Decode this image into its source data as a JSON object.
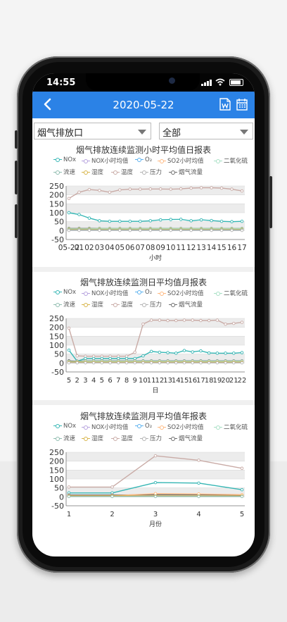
{
  "status": {
    "time": "14:55"
  },
  "header": {
    "title": "2020-05-22"
  },
  "filters": {
    "station": "烟气排放口",
    "scope": "全部"
  },
  "legend": {
    "row1": [
      "NOx",
      "NOX小时均值",
      "O₂",
      "SO2小时均值",
      "二氧化硫"
    ],
    "row2": [
      "流速",
      "湿度",
      "温度",
      "压力",
      "烟气流量"
    ]
  },
  "colors": {
    "header": "#2b82e6",
    "nox": "#35b6b4",
    "nox_avg": "#b6a2de",
    "o2": "#5ab1ef",
    "so2_avg": "#ffb980",
    "so2": "#a8e0c5",
    "flow": "#8fbcaf",
    "humidity": "#d8b54a",
    "temperature": "#c9aba6",
    "pressure": "#b3b3b3",
    "gas_flow": "#6e6e6e"
  },
  "chart_data": [
    {
      "type": "line",
      "title": "烟气排放连续监测小时平均值日报表",
      "xlabel": "小时",
      "ylabel": "",
      "ylim": [
        -50,
        250
      ],
      "yticks": [
        250,
        200,
        150,
        100,
        50,
        0,
        -50
      ],
      "categories": [
        "05-22",
        "01",
        "02",
        "03",
        "04",
        "05",
        "06",
        "07",
        "08",
        "09",
        "10",
        "11",
        "12",
        "13",
        "14",
        "15",
        "16",
        "17"
      ],
      "x_tick_labels": [
        "05-22",
        "01",
        "02",
        "03",
        "04",
        "05",
        "06",
        "07",
        "08",
        "09",
        "10",
        "11",
        "12",
        "13",
        "14",
        "15",
        "16",
        "17"
      ],
      "series": [
        {
          "name": "温度",
          "color": "#c9aba6",
          "values": [
            180,
            215,
            230,
            225,
            215,
            228,
            232,
            232,
            233,
            233,
            232,
            234,
            238,
            240,
            240,
            238,
            232,
            222
          ]
        },
        {
          "name": "NOx",
          "color": "#35b6b4",
          "values": [
            100,
            90,
            70,
            55,
            52,
            52,
            52,
            52,
            55,
            60,
            62,
            63,
            55,
            60,
            56,
            52,
            50,
            52
          ]
        },
        {
          "name": "烟气流量",
          "color": "#6e6e6e",
          "values": [
            12,
            12,
            12,
            12,
            12,
            12,
            12,
            12,
            12,
            12,
            12,
            12,
            12,
            12,
            12,
            12,
            12,
            12
          ]
        },
        {
          "name": "二氧化硫",
          "color": "#a8e0c5",
          "values": [
            10,
            10,
            10,
            11,
            11,
            11,
            11,
            11,
            11,
            11,
            11,
            11,
            11,
            11,
            11,
            11,
            11,
            11
          ]
        },
        {
          "name": "湿度",
          "color": "#d8b54a",
          "values": [
            7,
            7,
            7,
            7,
            7,
            7,
            7,
            7,
            7,
            7,
            7,
            7,
            7,
            7,
            7,
            7,
            7,
            7
          ]
        },
        {
          "name": "流速",
          "color": "#8fbcaf",
          "values": [
            4,
            4,
            4,
            4,
            4,
            4,
            4,
            4,
            4,
            4,
            4,
            4,
            4,
            4,
            4,
            4,
            4,
            4
          ]
        },
        {
          "name": "压力",
          "color": "#b3b3b3",
          "values": [
            1,
            1,
            1,
            1,
            1,
            1,
            1,
            1,
            1,
            1,
            1,
            1,
            1,
            1,
            1,
            1,
            1,
            1
          ]
        }
      ]
    },
    {
      "type": "line",
      "title": "烟气排放连续监测日平均值月报表",
      "xlabel": "日",
      "ylabel": "",
      "ylim": [
        -50,
        250
      ],
      "yticks": [
        250,
        200,
        150,
        100,
        50,
        0,
        -50
      ],
      "categories": [
        "5",
        "2",
        "3",
        "4",
        "5",
        "6",
        "7",
        "8",
        "9",
        "10",
        "11",
        "12",
        "13",
        "14",
        "15",
        "16",
        "17",
        "18",
        "19",
        "20",
        "21",
        "22"
      ],
      "x_tick_labels": [
        "5",
        "2",
        "3",
        "4",
        "5",
        "6",
        "7",
        "8",
        "9",
        "10",
        "11",
        "12",
        "13",
        "14",
        "15",
        "16",
        "17",
        "18",
        "19",
        "20",
        "21",
        "22"
      ],
      "series": [
        {
          "name": "温度",
          "color": "#c9aba6",
          "values": [
            195,
            40,
            38,
            38,
            38,
            38,
            38,
            38,
            60,
            218,
            240,
            240,
            238,
            238,
            240,
            240,
            238,
            238,
            240,
            218,
            222,
            228
          ]
        },
        {
          "name": "NOx",
          "color": "#35b6b4",
          "values": [
            72,
            10,
            25,
            25,
            25,
            25,
            25,
            25,
            25,
            40,
            65,
            60,
            58,
            55,
            70,
            62,
            68,
            56,
            55,
            55,
            55,
            58
          ]
        },
        {
          "name": "烟气流量",
          "color": "#6e6e6e",
          "values": [
            12,
            10,
            12,
            12,
            12,
            12,
            12,
            12,
            12,
            12,
            12,
            12,
            12,
            12,
            12,
            12,
            12,
            12,
            12,
            12,
            12,
            12
          ]
        },
        {
          "name": "二氧化硫",
          "color": "#a8e0c5",
          "values": [
            8,
            8,
            10,
            10,
            10,
            10,
            10,
            10,
            10,
            10,
            10,
            10,
            10,
            10,
            10,
            10,
            10,
            10,
            10,
            10,
            10,
            10
          ]
        },
        {
          "name": "湿度",
          "color": "#d8b54a",
          "values": [
            5,
            5,
            5,
            5,
            5,
            5,
            5,
            5,
            5,
            5,
            5,
            5,
            5,
            5,
            5,
            5,
            5,
            5,
            5,
            5,
            5,
            5
          ]
        },
        {
          "name": "压力",
          "color": "#b3b3b3",
          "values": [
            1,
            1,
            1,
            1,
            1,
            1,
            1,
            1,
            1,
            1,
            1,
            1,
            1,
            1,
            1,
            1,
            1,
            1,
            1,
            1,
            1,
            1
          ]
        }
      ]
    },
    {
      "type": "line",
      "title": "烟气排放连续监测月平均值年报表",
      "xlabel": "月份",
      "ylabel": "",
      "ylim": [
        -50,
        250
      ],
      "yticks": [
        250,
        200,
        150,
        100,
        50,
        0,
        -50
      ],
      "categories": [
        "1",
        "2",
        "3",
        "4",
        "5"
      ],
      "x_tick_labels": [
        "1",
        "2",
        "3",
        "4",
        "5"
      ],
      "series": [
        {
          "name": "温度",
          "color": "#c9aba6",
          "values": [
            55,
            55,
            230,
            205,
            160
          ]
        },
        {
          "name": "NOx",
          "color": "#35b6b4",
          "values": [
            22,
            22,
            80,
            77,
            40
          ]
        },
        {
          "name": "烟气流量",
          "color": "#6e6e6e",
          "values": [
            10,
            10,
            12,
            12,
            10
          ]
        },
        {
          "name": "SO2小时均值",
          "color": "#ffb980",
          "values": [
            6,
            6,
            18,
            16,
            12
          ]
        },
        {
          "name": "湿度",
          "color": "#d8b54a",
          "values": [
            5,
            5,
            5,
            5,
            5
          ]
        },
        {
          "name": "流速",
          "color": "#8fbcaf",
          "values": [
            2,
            2,
            2,
            2,
            2
          ]
        }
      ]
    }
  ]
}
